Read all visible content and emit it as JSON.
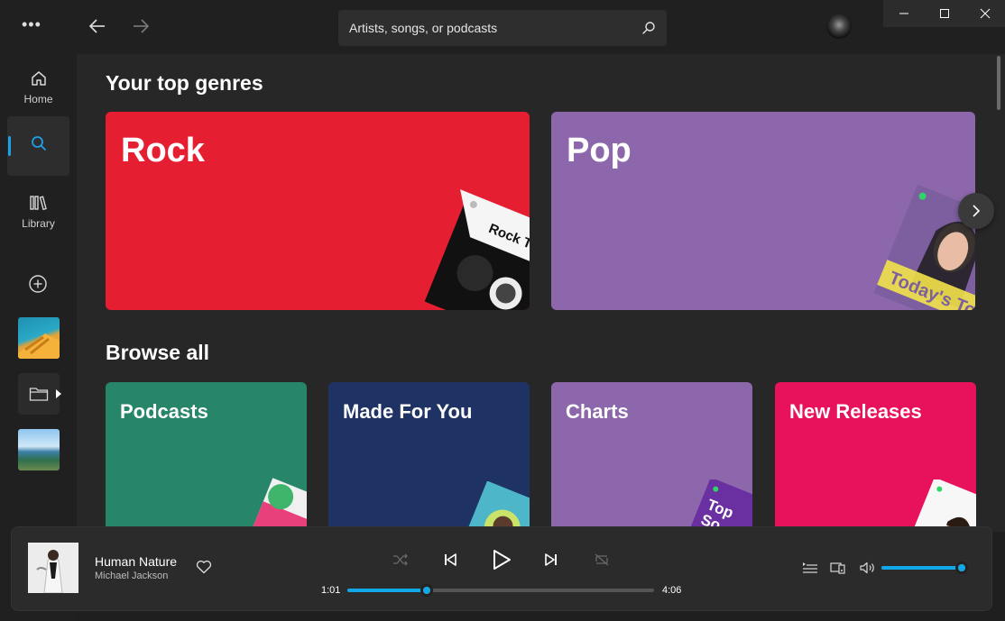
{
  "app": {
    "menu_label": "•••"
  },
  "nav": {
    "home": "Home",
    "search": "Search",
    "library": "Library"
  },
  "search": {
    "placeholder": "Artists, songs, or podcasts"
  },
  "sections": {
    "top_genres": "Your top genres",
    "browse_all": "Browse all"
  },
  "genres": [
    {
      "title": "Rock",
      "color": "#e61e32",
      "cover_text": "Rock This"
    },
    {
      "title": "Pop",
      "color": "#8d67ab",
      "cover_text": "Today's Top Hits"
    }
  ],
  "browse": [
    {
      "title": "Podcasts",
      "color": "#27856a"
    },
    {
      "title": "Made For You",
      "color": "#1e3264"
    },
    {
      "title": "Charts",
      "color": "#8d67ab"
    },
    {
      "title": "New Releases",
      "color": "#e8115b"
    }
  ],
  "player": {
    "song": "Human Nature",
    "artist": "Michael Jackson",
    "elapsed": "1:01",
    "duration": "4:06",
    "progress": 0.26,
    "volume": 0.95,
    "accent": "#0fa8e8"
  }
}
